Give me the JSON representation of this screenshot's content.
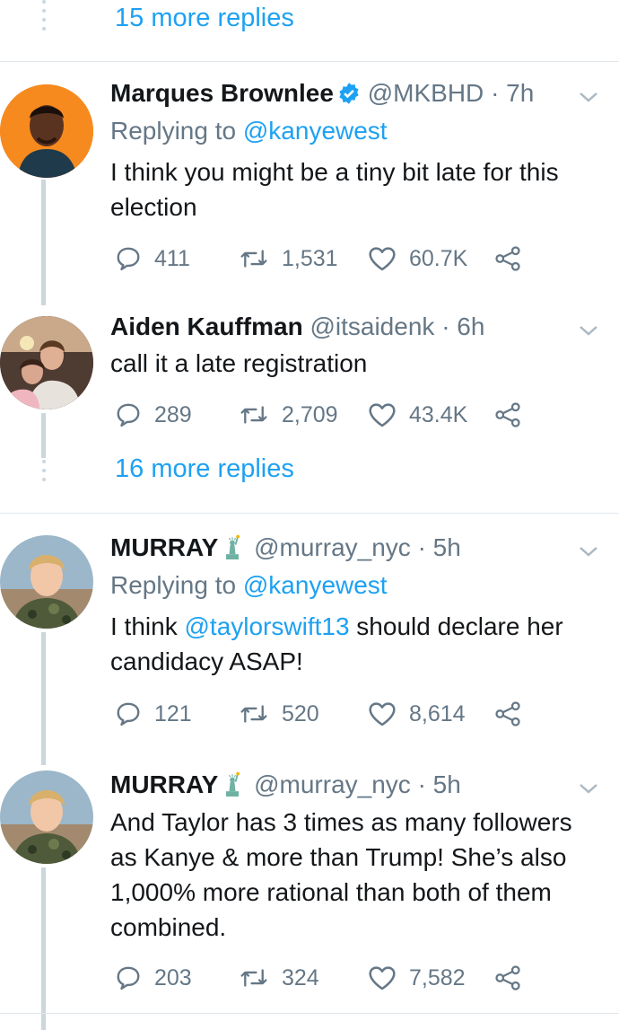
{
  "thread_top": {
    "more_replies": "15 more replies"
  },
  "thread_mid": {
    "more_replies": "16 more replies"
  },
  "tweets": [
    {
      "name": "Marques Brownlee",
      "handle": "@MKBHD",
      "time": "· 7h",
      "replying_label": "Replying to",
      "replying_to": "@kanyewest",
      "text": "I think you might be a tiny bit late for this election",
      "replies": "411",
      "retweets": "1,531",
      "likes": "60.7K",
      "verified": true
    },
    {
      "name": "Aiden Kauffman",
      "handle": "@itsaidenk",
      "time": "· 6h",
      "text": "call it a late registration",
      "replies": "289",
      "retweets": "2,709",
      "likes": "43.4K"
    },
    {
      "name": "MURRAY",
      "handle": "@murray_nyc",
      "time": "· 5h",
      "replying_label": "Replying to",
      "replying_to": "@kanyewest",
      "text_before": "I think ",
      "text_mention": "@taylorswift13",
      "text_after": " should declare her candidacy ASAP!",
      "replies": "121",
      "retweets": "520",
      "likes": "8,614"
    },
    {
      "name": "MURRAY",
      "handle": "@murray_nyc",
      "time": "· 5h",
      "text": "And Taylor has 3 times as many followers as Kanye & more than Trump! She’s also 1,000% more rational than both of them combined.",
      "replies": "203",
      "retweets": "324",
      "likes": "7,582"
    }
  ],
  "icons": {
    "reply": "reply-icon",
    "retweet": "retweet-icon",
    "like": "heart-icon",
    "share": "share-icon",
    "caret": "chevron-down-icon",
    "verified": "verified-badge-icon",
    "name_emoji": "statue-of-liberty-emoji"
  },
  "colors": {
    "link": "#1da1f2",
    "muted": "#657786",
    "rail": "#ccd6dd"
  }
}
